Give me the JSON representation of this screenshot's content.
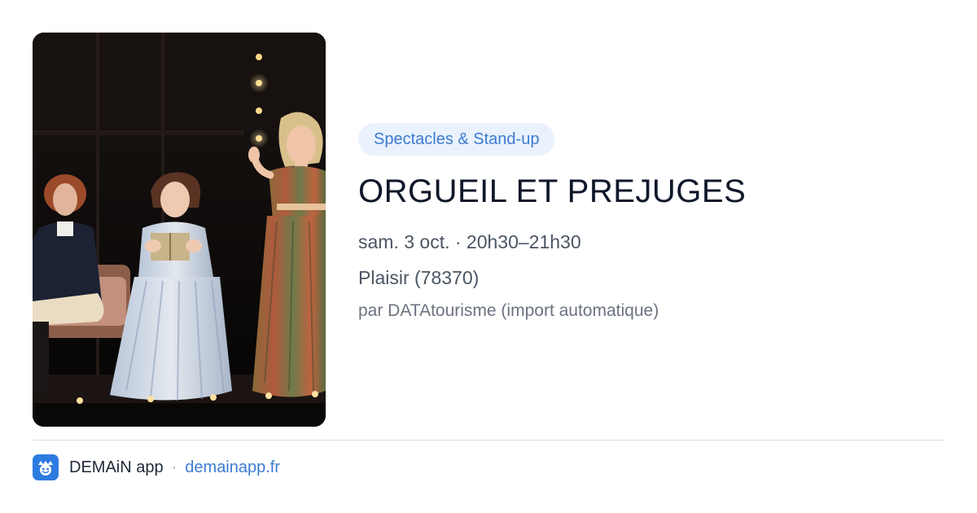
{
  "event": {
    "category": "Spectacles & Stand-up",
    "title": "ORGUEIL ET PREJUGES",
    "when": "sam. 3 oct. · 20h30–21h30",
    "where": "Plaisir (78370)",
    "source": "par DATAtourisme (import automatique)"
  },
  "footer": {
    "app_name": "DEMAiN app",
    "separator": "·",
    "url": "demainapp.fr"
  },
  "colors": {
    "accent": "#3b7bd0",
    "tag_background": "#eaf2fd",
    "title": "#0f172a",
    "muted": "#6b7280"
  },
  "icons": {
    "app": "demain-app-icon"
  }
}
